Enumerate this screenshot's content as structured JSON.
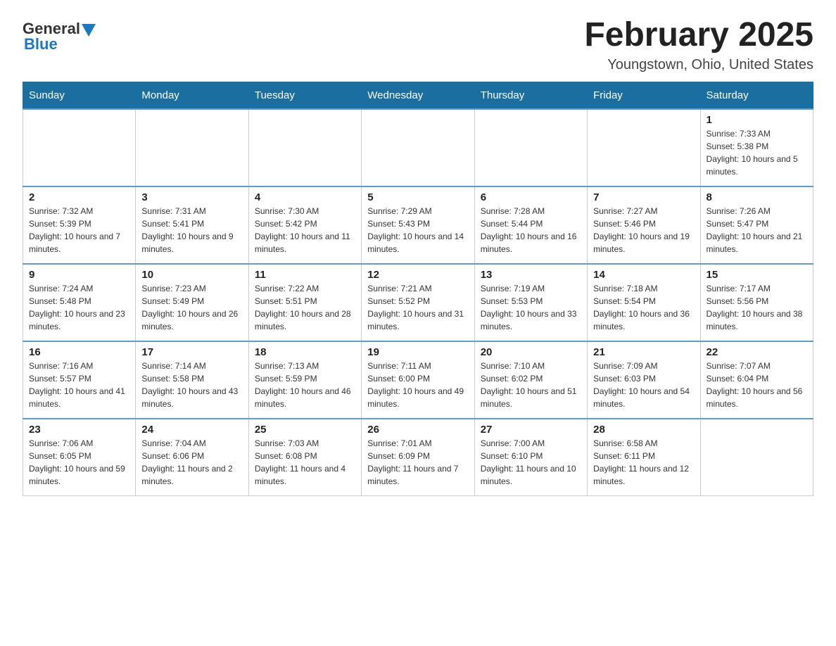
{
  "header": {
    "logo": {
      "general": "General",
      "blue": "Blue"
    },
    "title": "February 2025",
    "location": "Youngstown, Ohio, United States"
  },
  "days_of_week": [
    "Sunday",
    "Monday",
    "Tuesday",
    "Wednesday",
    "Thursday",
    "Friday",
    "Saturday"
  ],
  "weeks": [
    [
      {
        "day": "",
        "info": ""
      },
      {
        "day": "",
        "info": ""
      },
      {
        "day": "",
        "info": ""
      },
      {
        "day": "",
        "info": ""
      },
      {
        "day": "",
        "info": ""
      },
      {
        "day": "",
        "info": ""
      },
      {
        "day": "1",
        "info": "Sunrise: 7:33 AM\nSunset: 5:38 PM\nDaylight: 10 hours and 5 minutes."
      }
    ],
    [
      {
        "day": "2",
        "info": "Sunrise: 7:32 AM\nSunset: 5:39 PM\nDaylight: 10 hours and 7 minutes."
      },
      {
        "day": "3",
        "info": "Sunrise: 7:31 AM\nSunset: 5:41 PM\nDaylight: 10 hours and 9 minutes."
      },
      {
        "day": "4",
        "info": "Sunrise: 7:30 AM\nSunset: 5:42 PM\nDaylight: 10 hours and 11 minutes."
      },
      {
        "day": "5",
        "info": "Sunrise: 7:29 AM\nSunset: 5:43 PM\nDaylight: 10 hours and 14 minutes."
      },
      {
        "day": "6",
        "info": "Sunrise: 7:28 AM\nSunset: 5:44 PM\nDaylight: 10 hours and 16 minutes."
      },
      {
        "day": "7",
        "info": "Sunrise: 7:27 AM\nSunset: 5:46 PM\nDaylight: 10 hours and 19 minutes."
      },
      {
        "day": "8",
        "info": "Sunrise: 7:26 AM\nSunset: 5:47 PM\nDaylight: 10 hours and 21 minutes."
      }
    ],
    [
      {
        "day": "9",
        "info": "Sunrise: 7:24 AM\nSunset: 5:48 PM\nDaylight: 10 hours and 23 minutes."
      },
      {
        "day": "10",
        "info": "Sunrise: 7:23 AM\nSunset: 5:49 PM\nDaylight: 10 hours and 26 minutes."
      },
      {
        "day": "11",
        "info": "Sunrise: 7:22 AM\nSunset: 5:51 PM\nDaylight: 10 hours and 28 minutes."
      },
      {
        "day": "12",
        "info": "Sunrise: 7:21 AM\nSunset: 5:52 PM\nDaylight: 10 hours and 31 minutes."
      },
      {
        "day": "13",
        "info": "Sunrise: 7:19 AM\nSunset: 5:53 PM\nDaylight: 10 hours and 33 minutes."
      },
      {
        "day": "14",
        "info": "Sunrise: 7:18 AM\nSunset: 5:54 PM\nDaylight: 10 hours and 36 minutes."
      },
      {
        "day": "15",
        "info": "Sunrise: 7:17 AM\nSunset: 5:56 PM\nDaylight: 10 hours and 38 minutes."
      }
    ],
    [
      {
        "day": "16",
        "info": "Sunrise: 7:16 AM\nSunset: 5:57 PM\nDaylight: 10 hours and 41 minutes."
      },
      {
        "day": "17",
        "info": "Sunrise: 7:14 AM\nSunset: 5:58 PM\nDaylight: 10 hours and 43 minutes."
      },
      {
        "day": "18",
        "info": "Sunrise: 7:13 AM\nSunset: 5:59 PM\nDaylight: 10 hours and 46 minutes."
      },
      {
        "day": "19",
        "info": "Sunrise: 7:11 AM\nSunset: 6:00 PM\nDaylight: 10 hours and 49 minutes."
      },
      {
        "day": "20",
        "info": "Sunrise: 7:10 AM\nSunset: 6:02 PM\nDaylight: 10 hours and 51 minutes."
      },
      {
        "day": "21",
        "info": "Sunrise: 7:09 AM\nSunset: 6:03 PM\nDaylight: 10 hours and 54 minutes."
      },
      {
        "day": "22",
        "info": "Sunrise: 7:07 AM\nSunset: 6:04 PM\nDaylight: 10 hours and 56 minutes."
      }
    ],
    [
      {
        "day": "23",
        "info": "Sunrise: 7:06 AM\nSunset: 6:05 PM\nDaylight: 10 hours and 59 minutes."
      },
      {
        "day": "24",
        "info": "Sunrise: 7:04 AM\nSunset: 6:06 PM\nDaylight: 11 hours and 2 minutes."
      },
      {
        "day": "25",
        "info": "Sunrise: 7:03 AM\nSunset: 6:08 PM\nDaylight: 11 hours and 4 minutes."
      },
      {
        "day": "26",
        "info": "Sunrise: 7:01 AM\nSunset: 6:09 PM\nDaylight: 11 hours and 7 minutes."
      },
      {
        "day": "27",
        "info": "Sunrise: 7:00 AM\nSunset: 6:10 PM\nDaylight: 11 hours and 10 minutes."
      },
      {
        "day": "28",
        "info": "Sunrise: 6:58 AM\nSunset: 6:11 PM\nDaylight: 11 hours and 12 minutes."
      },
      {
        "day": "",
        "info": ""
      }
    ]
  ],
  "accent_color": "#1a6fa0"
}
